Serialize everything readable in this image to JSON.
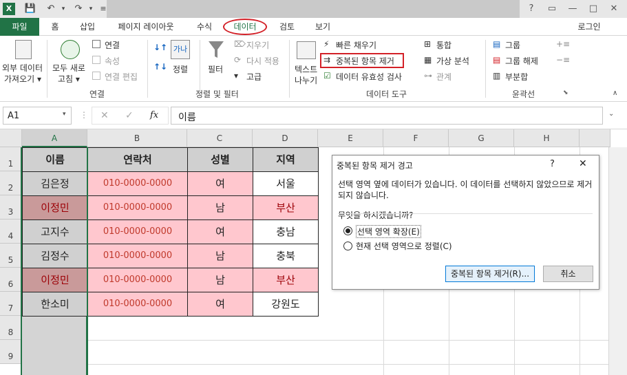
{
  "app": {
    "colors": {
      "accent": "#217346",
      "highlight_red": "#d32027",
      "pink_fill": "#ffc7ce",
      "dup_fill": "#c99a9a",
      "header_gray": "#d0d0d0"
    }
  },
  "titlebar": {
    "help": "?",
    "minimize": "—",
    "restore": "□",
    "close": "✕"
  },
  "tabs": [
    "파일",
    "홈",
    "삽입",
    "페이지 레이아웃",
    "수식",
    "데이터",
    "검토",
    "보기"
  ],
  "account": "로그인",
  "ribbon": {
    "external_data": [
      "외부 데이터",
      "가져오기 ▾"
    ],
    "refresh_all": [
      "모두 새로",
      "고침 ▾"
    ],
    "conn_items": [
      "연결",
      "속성",
      "연결 편집"
    ],
    "group_connections": "연결",
    "sort_label": "정렬",
    "filter_label": "필터",
    "filter_items": [
      "지우기",
      "다시 적용",
      "고급"
    ],
    "group_sort_filter": "정렬 및 필터",
    "text_to_columns": [
      "텍스트",
      "나누기"
    ],
    "tools_items": [
      "빠른 채우기",
      "중복된 항목 제거",
      "데이터 유효성 검사"
    ],
    "tools_items2": [
      "통합",
      "가상 분석",
      "관계"
    ],
    "group_data_tools": "데이터 도구",
    "outline_items": [
      "그룹",
      "그룹 해제",
      "부분합"
    ],
    "group_outline": "윤곽선"
  },
  "formula_bar": {
    "name_box": "A1",
    "fx": "fx",
    "content": "이름"
  },
  "sheet": {
    "col_headers": [
      "A",
      "B",
      "C",
      "D",
      "E",
      "F",
      "G",
      "H"
    ],
    "row_headers": [
      "1",
      "2",
      "3",
      "4",
      "5",
      "6",
      "7",
      "8",
      "9"
    ],
    "header_row": [
      "이름",
      "연락처",
      "성별",
      "지역"
    ],
    "rows": [
      [
        "김은정",
        "010-0000-0000",
        "여",
        "서울"
      ],
      [
        "이정민",
        "010-0000-0000",
        "남",
        "부산"
      ],
      [
        "고지수",
        "010-0000-0000",
        "여",
        "충남"
      ],
      [
        "김정수",
        "010-0000-0000",
        "남",
        "충북"
      ],
      [
        "이정민",
        "010-0000-0000",
        "남",
        "부산"
      ],
      [
        "한소미",
        "010-0000-0000",
        "여",
        "강원도"
      ]
    ]
  },
  "dialog": {
    "title": "중복된 항목 제거 경고",
    "help": "?",
    "close": "✕",
    "message": "선택 영역 옆에 데이터가 있습니다. 이 데이터를 선택하지 않았으므로 제거되지 않습니다.",
    "question": "무엇을 하시겠습니까?",
    "option1": "선택 영역 확장(E)",
    "option2": "현재 선택 영역으로 정렬(C)",
    "ok_button": "중복된 항목 제거(R)...",
    "cancel_button": "취소"
  }
}
